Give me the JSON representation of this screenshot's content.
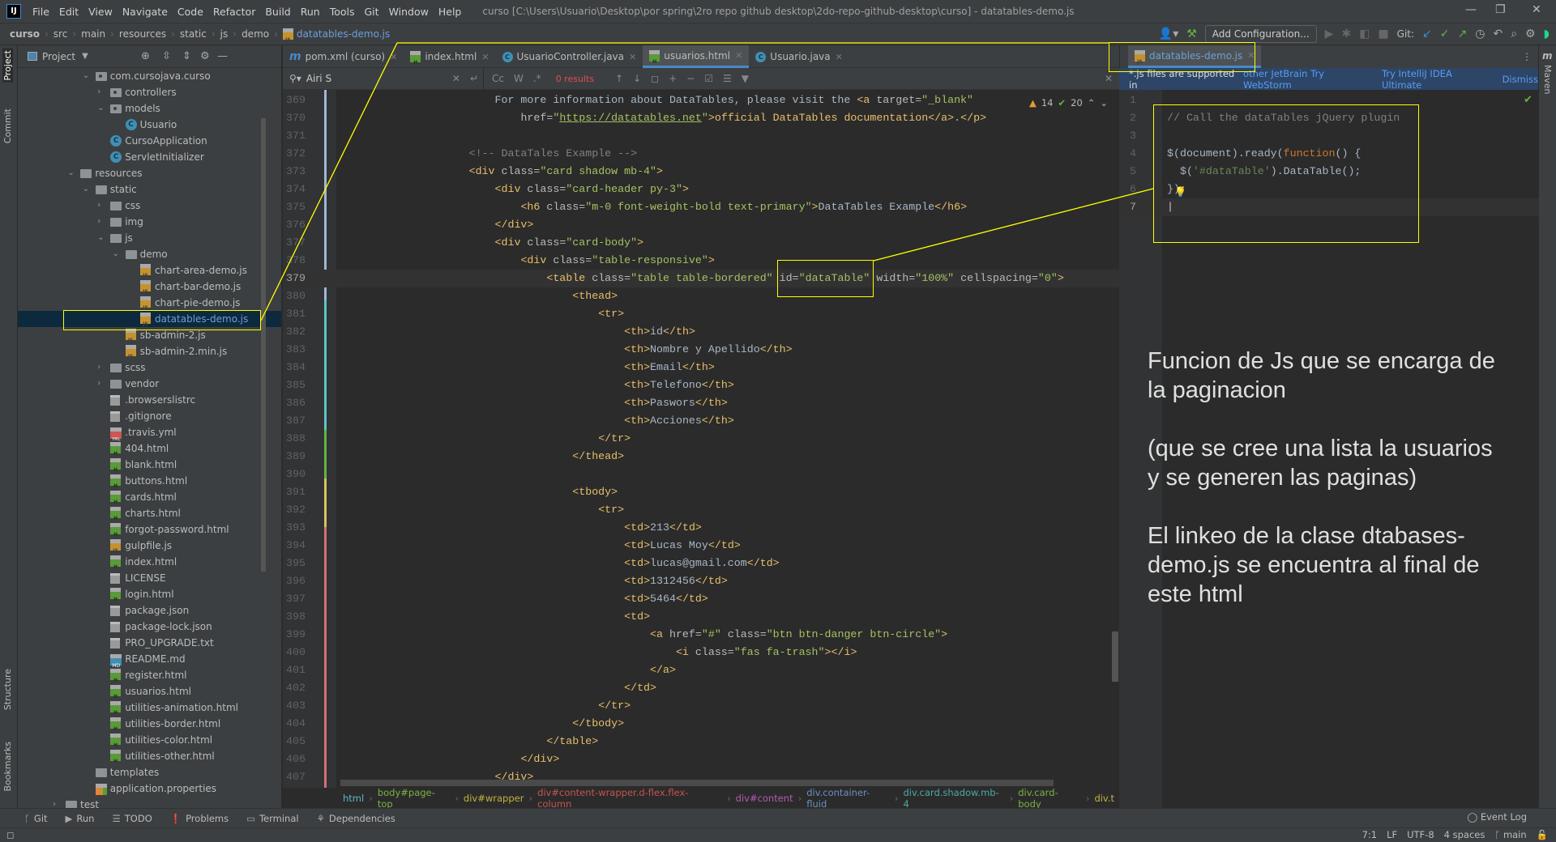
{
  "menubar": {
    "items": [
      "File",
      "Edit",
      "View",
      "Navigate",
      "Code",
      "Refactor",
      "Build",
      "Run",
      "Tools",
      "Git",
      "Window",
      "Help"
    ],
    "title": "curso [C:\\Users\\Usuario\\Desktop\\por spring\\2ro repo github desktop\\2do-repo-github-desktop\\curso] - datatables-demo.js"
  },
  "navbar": {
    "crumbs": [
      "curso",
      "src",
      "main",
      "resources",
      "static",
      "js",
      "demo"
    ],
    "file": "datatables-demo.js"
  },
  "toolbar": {
    "add_config": "Add Configuration...",
    "git_label": "Git:"
  },
  "left_strip": {
    "project": "Project",
    "commit": "Commit",
    "structure": "Structure",
    "bookmarks": "Bookmarks"
  },
  "right_strip": {
    "maven": "Maven"
  },
  "project": {
    "title": "Project",
    "tree": [
      {
        "level": 2,
        "arrow": "open",
        "icon": "pkg",
        "label": "com.cursojava.curso"
      },
      {
        "level": 3,
        "arrow": "closed",
        "icon": "pkg",
        "label": "controllers"
      },
      {
        "level": 3,
        "arrow": "open",
        "icon": "pkg",
        "label": "models"
      },
      {
        "level": 4,
        "icon": "class",
        "label": "Usuario"
      },
      {
        "level": 3,
        "icon": "class",
        "label": "CursoApplication"
      },
      {
        "level": 3,
        "icon": "class",
        "label": "ServletInitializer"
      },
      {
        "level": 1,
        "arrow": "open",
        "icon": "folder",
        "label": "resources"
      },
      {
        "level": 2,
        "arrow": "open",
        "icon": "folder",
        "label": "static"
      },
      {
        "level": 3,
        "arrow": "closed",
        "icon": "folder",
        "label": "css"
      },
      {
        "level": 3,
        "arrow": "closed",
        "icon": "folder",
        "label": "img"
      },
      {
        "level": 3,
        "arrow": "open",
        "icon": "folder",
        "label": "js"
      },
      {
        "level": 4,
        "arrow": "open",
        "icon": "folder",
        "label": "demo"
      },
      {
        "level": 5,
        "icon": "js",
        "label": "chart-area-demo.js"
      },
      {
        "level": 5,
        "icon": "js",
        "label": "chart-bar-demo.js"
      },
      {
        "level": 5,
        "icon": "js",
        "label": "chart-pie-demo.js"
      },
      {
        "level": 5,
        "icon": "js",
        "label": "datatables-demo.js",
        "selected": true
      },
      {
        "level": 4,
        "icon": "js",
        "label": "sb-admin-2.js"
      },
      {
        "level": 4,
        "icon": "js",
        "label": "sb-admin-2.min.js"
      },
      {
        "level": 3,
        "arrow": "closed",
        "icon": "folder",
        "label": "scss"
      },
      {
        "level": 3,
        "arrow": "closed",
        "icon": "folder",
        "label": "vendor"
      },
      {
        "level": 3,
        "icon": "text",
        "label": ".browserslistrc"
      },
      {
        "level": 3,
        "icon": "text",
        "label": ".gitignore"
      },
      {
        "level": 3,
        "icon": "yml",
        "label": ".travis.yml"
      },
      {
        "level": 3,
        "icon": "html",
        "label": "404.html"
      },
      {
        "level": 3,
        "icon": "html",
        "label": "blank.html"
      },
      {
        "level": 3,
        "icon": "html",
        "label": "buttons.html"
      },
      {
        "level": 3,
        "icon": "html",
        "label": "cards.html"
      },
      {
        "level": 3,
        "icon": "html",
        "label": "charts.html"
      },
      {
        "level": 3,
        "icon": "html",
        "label": "forgot-password.html"
      },
      {
        "level": 3,
        "icon": "js",
        "label": "gulpfile.js"
      },
      {
        "level": 3,
        "icon": "html",
        "label": "index.html"
      },
      {
        "level": 3,
        "icon": "text",
        "label": "LICENSE"
      },
      {
        "level": 3,
        "icon": "html",
        "label": "login.html"
      },
      {
        "level": 3,
        "icon": "text",
        "label": "package.json"
      },
      {
        "level": 3,
        "icon": "text",
        "label": "package-lock.json"
      },
      {
        "level": 3,
        "icon": "text",
        "label": "PRO_UPGRADE.txt"
      },
      {
        "level": 3,
        "icon": "md",
        "label": "README.md"
      },
      {
        "level": 3,
        "icon": "html",
        "label": "register.html"
      },
      {
        "level": 3,
        "icon": "html",
        "label": "usuarios.html"
      },
      {
        "level": 3,
        "icon": "html",
        "label": "utilities-animation.html"
      },
      {
        "level": 3,
        "icon": "html",
        "label": "utilities-border.html"
      },
      {
        "level": 3,
        "icon": "html",
        "label": "utilities-color.html"
      },
      {
        "level": 3,
        "icon": "html",
        "label": "utilities-other.html"
      },
      {
        "level": 2,
        "icon": "folder",
        "label": "templates"
      },
      {
        "level": 2,
        "icon": "prop",
        "label": "application.properties"
      },
      {
        "level": 0,
        "arrow": "closed",
        "icon": "folder",
        "label": "test"
      }
    ]
  },
  "tabs": [
    {
      "icon": "maven",
      "label": "pom.xml (curso)"
    },
    {
      "icon": "html",
      "label": "index.html"
    },
    {
      "icon": "class",
      "label": "UsuarioController.java"
    },
    {
      "icon": "html",
      "label": "usuarios.html",
      "active": true
    },
    {
      "icon": "class",
      "label": "Usuario.java"
    }
  ],
  "findbar": {
    "query": "Airi S",
    "results": "0 results"
  },
  "inspections": {
    "warnings": "14",
    "typos": "20"
  },
  "editor": {
    "first_line": 369,
    "current_line": 379,
    "lines": [
      "                        For more information about DataTables, please visit the <a target=\"_blank\"",
      "                            href=\"https://datatables.net\">official DataTables documentation</a>.</p>",
      "",
      "                    <!-- DataTales Example -->",
      "                    <div class=\"card shadow mb-4\">",
      "                        <div class=\"card-header py-3\">",
      "                            <h6 class=\"m-0 font-weight-bold text-primary\">DataTables Example</h6>",
      "                        </div>",
      "                        <div class=\"card-body\">",
      "                            <div class=\"table-responsive\">",
      "                                <table class=\"table table-bordered\" id=\"dataTable\" width=\"100%\" cellspacing=\"0\">",
      "                                    <thead>",
      "                                        <tr>",
      "                                            <th>id</th>",
      "                                            <th>Nombre y Apellido</th>",
      "                                            <th>Email</th>",
      "                                            <th>Telefono</th>",
      "                                            <th>Paswors</th>",
      "                                            <th>Acciones</th>",
      "                                        </tr>",
      "                                    </thead>",
      "",
      "                                    <tbody>",
      "                                        <tr>",
      "                                            <td>213</td>",
      "                                            <td>Lucas Moy</td>",
      "                                            <td>lucas@gmail.com</td>",
      "                                            <td>1312456</td>",
      "                                            <td>5464</td>",
      "                                            <td>",
      "                                                <a href=\"#\" class=\"btn btn-danger btn-circle\">",
      "                                                    <i class=\"fas fa-trash\"></i>",
      "                                                </a>",
      "                                            </td>",
      "                                        </tr>",
      "                                    </tbody>",
      "                                </table>",
      "                            </div>",
      "                        </div>"
    ]
  },
  "bottom_breadcrumb": [
    {
      "label": "html",
      "color": "#5fb6c9"
    },
    {
      "label": "body#page-top",
      "color": "#7cb342"
    },
    {
      "label": "div#wrapper",
      "color": "#c0b340"
    },
    {
      "label": "div#content-wrapper.d-flex.flex-column",
      "color": "#c75450"
    },
    {
      "label": "div#content",
      "color": "#b45ab4"
    },
    {
      "label": "div.container-fluid",
      "color": "#6d8fc0"
    },
    {
      "label": "div.card.shadow.mb-4",
      "color": "#4fa8a8"
    },
    {
      "label": "div.card-body",
      "color": "#7cb342"
    },
    {
      "label": "div.t",
      "color": "#c0b340"
    }
  ],
  "right_editor": {
    "tab": "datatables-demo.js",
    "banner": {
      "text": "*.js files are supported in",
      "link1": "other JetBrain Try WebStorm",
      "link2": "Try IntelliJ IDEA Ultimate",
      "dismiss": "Dismiss"
    },
    "current_line": 7,
    "lines": [
      "",
      "// Call the dataTables jQuery plugin",
      "",
      "$(document).ready(function() {",
      "  $('#dataTable').DataTable();",
      "});",
      ""
    ]
  },
  "annotation": [
    "Funcion de Js que se encarga de",
    "la paginacion",
    "",
    "(que se cree una lista la usuarios",
    "y se generen las paginas)",
    "",
    "El linkeo de la clase dtabases-",
    "demo.js se encuentra al final de",
    "este html"
  ],
  "toolwindows": [
    "Git",
    "Run",
    "TODO",
    "Problems",
    "Terminal",
    "Dependencies"
  ],
  "event_log": "Event Log",
  "status": {
    "position": "7:1",
    "line_sep": "LF",
    "encoding": "UTF-8",
    "indent": "4 spaces",
    "branch": "main"
  },
  "colors": {
    "highlight": "#ffff00",
    "accent": "#4a88c7"
  }
}
